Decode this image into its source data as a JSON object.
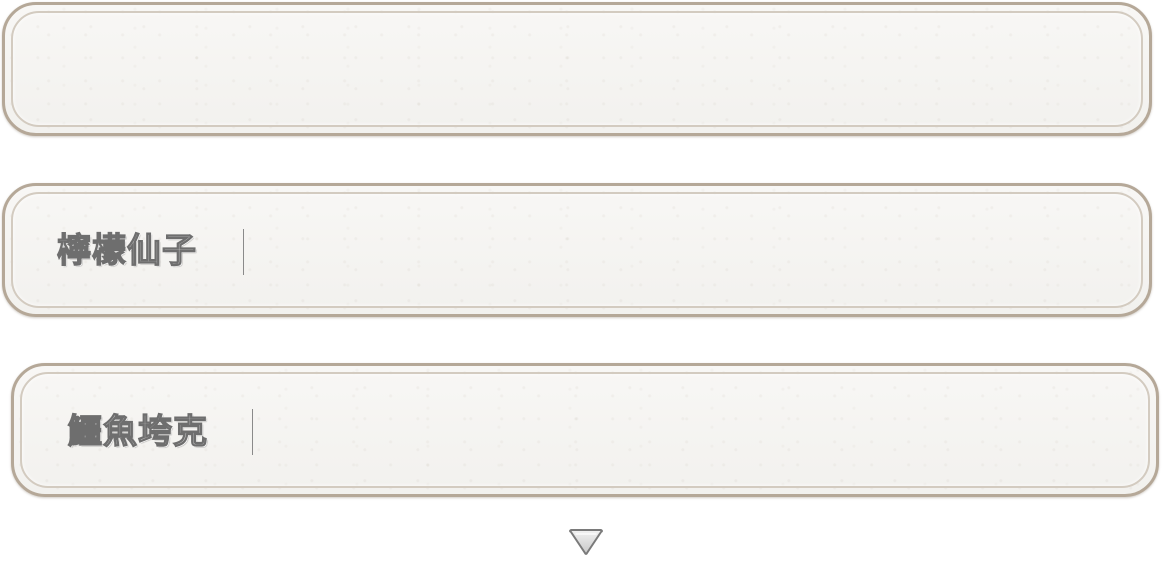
{
  "slots": [
    {
      "name": ""
    },
    {
      "name": "檸檬仙子"
    },
    {
      "name": "鱷魚垮克"
    }
  ],
  "more_icon": "chevron-down-triangle-icon"
}
